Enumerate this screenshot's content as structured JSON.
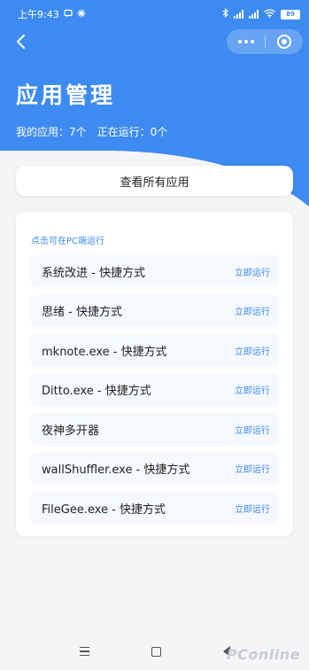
{
  "status_bar": {
    "time_label": "上午9:43",
    "battery_level": "89"
  },
  "header": {
    "title": "应用管理",
    "stat_apps": "我的应用：7个",
    "stat_running": "正在运行：0个"
  },
  "view_all_label": "查看所有应用",
  "apps_section": {
    "label": "点击可在PC端运行",
    "items": [
      {
        "name": "系统改进 - 快捷方式",
        "action": "立即运行"
      },
      {
        "name": "思绪 - 快捷方式",
        "action": "立即运行"
      },
      {
        "name": "mknote.exe - 快捷方式",
        "action": "立即运行"
      },
      {
        "name": "Ditto.exe - 快捷方式",
        "action": "立即运行"
      },
      {
        "name": "夜神多开器",
        "action": "立即运行"
      },
      {
        "name": "wallShuffler.exe - 快捷方式",
        "action": "立即运行"
      },
      {
        "name": "FileGee.exe - 快捷方式",
        "action": "立即运行"
      }
    ]
  },
  "watermark": "PConline",
  "colors": {
    "accent": "#3d8bf0",
    "background": "#f4f5f7"
  }
}
